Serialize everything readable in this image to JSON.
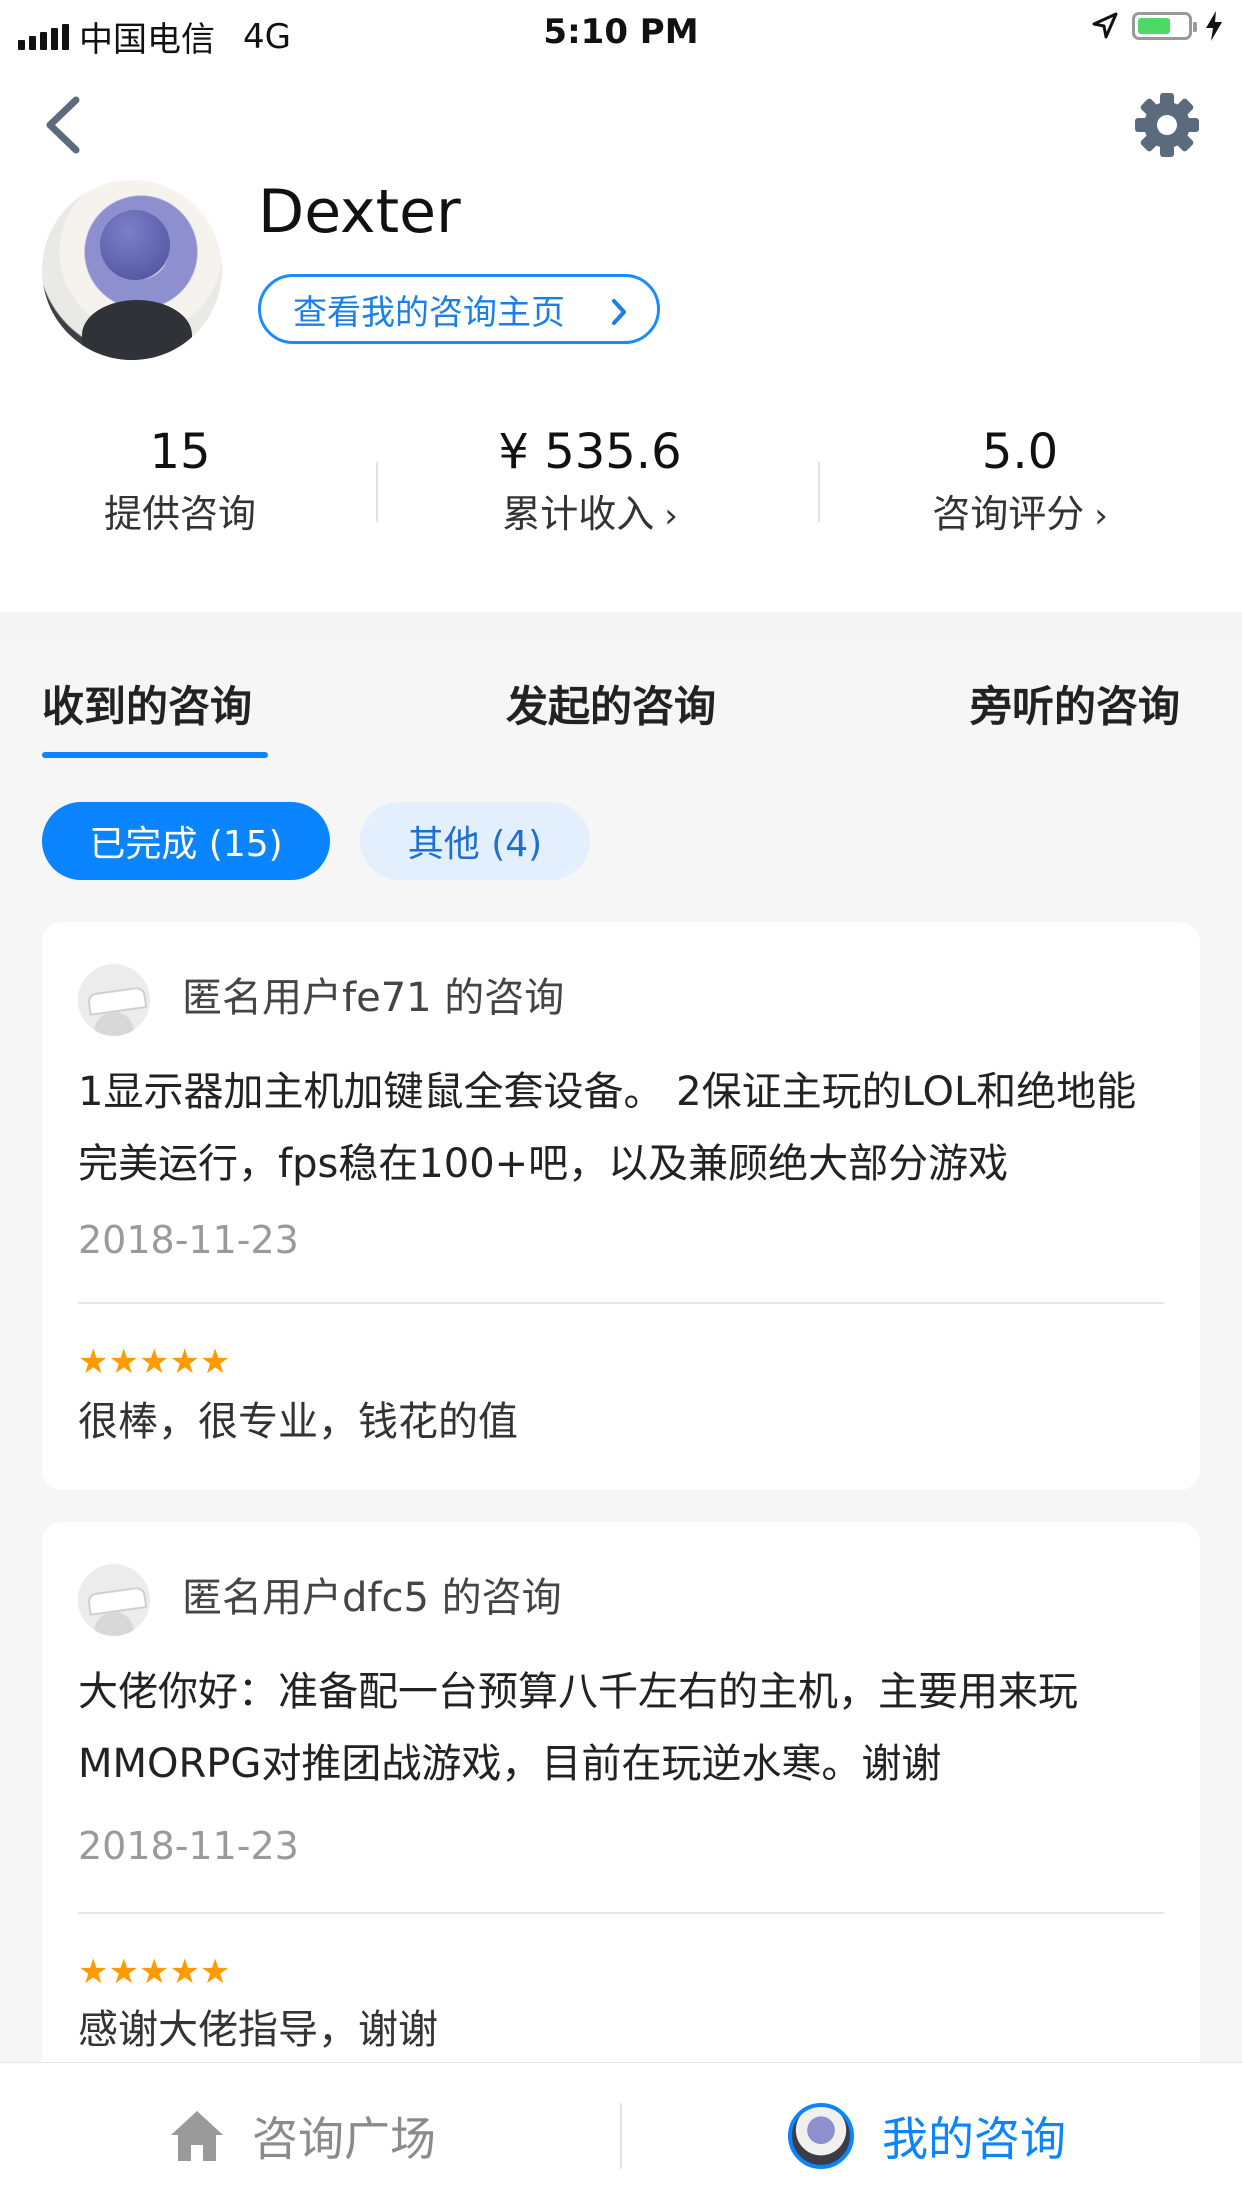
{
  "status_bar": {
    "carrier": "中国电信",
    "network": "4G",
    "time": "5:10 PM"
  },
  "header": {
    "back_icon": "chevron-left-icon",
    "settings_icon": "gear-icon"
  },
  "profile": {
    "username": "Dexter",
    "homepage_link": "查看我的咨询主页"
  },
  "stats": [
    {
      "value": "15",
      "label": "提供咨询",
      "has_arrow": false
    },
    {
      "value": "¥ 535.6",
      "label": "累计收入",
      "has_arrow": true
    },
    {
      "value": "5.0",
      "label": "咨询评分",
      "has_arrow": true
    }
  ],
  "tabs": [
    {
      "label": "收到的咨询",
      "active": true
    },
    {
      "label": "发起的咨询",
      "active": false
    },
    {
      "label": "旁听的咨询",
      "active": false
    }
  ],
  "filters": [
    {
      "label": "已完成 (15)",
      "active": true
    },
    {
      "label": "其他 (4)",
      "active": false
    }
  ],
  "consultations": [
    {
      "title": "匿名用户fe71 的咨询",
      "content": "1显示器加主机加键鼠全套设备。 2保证主玩的LOL和绝地能完美运行，fps稳在100+吧，以及兼顾绝大部分游戏",
      "date": "2018-11-23",
      "rating": 5,
      "stars": "★★★★★",
      "review": "很棒，很专业，钱花的值"
    },
    {
      "title": "匿名用户dfc5 的咨询",
      "content": "大佬你好：准备配一台预算八千左右的主机，主要用来玩MMORPG对推团战游戏，目前在玩逆水寒。谢谢",
      "date": "2018-11-23",
      "rating": 5,
      "stars": "★★★★★",
      "review": "感谢大佬指导，谢谢"
    }
  ],
  "bottom_nav": {
    "plaza": "咨询广场",
    "mine": "我的咨询"
  },
  "colors": {
    "accent": "#0a84ff",
    "star": "#ff9a00",
    "battery": "#4cd964"
  }
}
